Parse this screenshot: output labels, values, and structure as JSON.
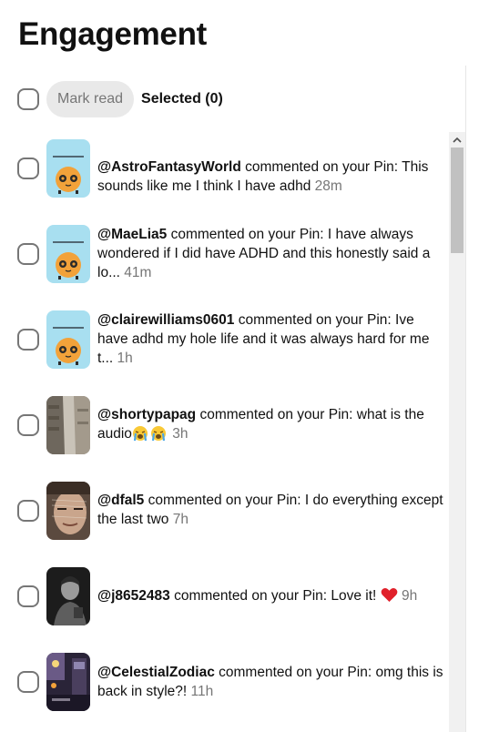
{
  "page": {
    "title": "Engagement"
  },
  "toolbar": {
    "mark_read_label": "Mark read",
    "selected_label": "Selected (0)"
  },
  "notifications": [
    {
      "user": "@AstroFantasyWorld",
      "action": " commented on your Pin: This sounds like me I think I have adhd ",
      "time": "28m",
      "thumb": "book-cover-cartoon"
    },
    {
      "user": "@MaeLia5",
      "action": " commented on your Pin: I have always wondered if I did have ADHD and this honestly said a lo... ",
      "time": "41m",
      "thumb": "book-cover-cartoon"
    },
    {
      "user": "@clairewilliams0601",
      "action": " commented on your Pin: Ive have adhd my hole life and it was always hard for me t... ",
      "time": "1h",
      "thumb": "book-cover-cartoon"
    },
    {
      "user": "@shortypapag",
      "action": " commented on your Pin: what is the audio",
      "time": "3h",
      "thumb": "store-aisle-photo",
      "emoji": "loudly-crying-face"
    },
    {
      "user": "@dfal5",
      "action": " commented on your Pin: I do everything except the last two ",
      "time": "7h",
      "thumb": "face-photo"
    },
    {
      "user": "@j8652483",
      "action": " commented on your Pin: Love it! ",
      "time": "9h",
      "thumb": "dark-portrait-photo",
      "emoji": "red-heart"
    },
    {
      "user": "@CelestialZodiac",
      "action": " commented on your Pin: omg this is back in style?! ",
      "time": "11h",
      "thumb": "night-room-photo"
    }
  ],
  "colors": {
    "thumb_cyan": "#a8dff0",
    "mascot_orange": "#f2a23a",
    "heart_red": "#e0202a",
    "muted_text": "#767676"
  }
}
